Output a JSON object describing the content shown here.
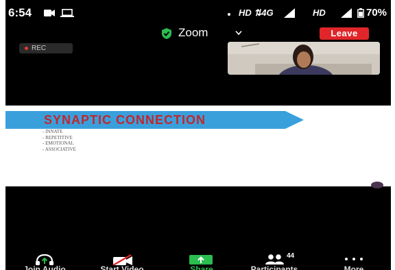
{
  "status_bar": {
    "time": "6:54",
    "network_left": "HD ⇅4G",
    "network_right": "HD",
    "battery": "70%"
  },
  "header": {
    "app_title": "Zoom",
    "leave_label": "Leave",
    "rec_label": "REC"
  },
  "slide": {
    "title": "SYNAPTIC CONNECTION",
    "bullets": [
      "- INNATE",
      "- REPETITIVE",
      "- EMOTIONAL",
      "- ASSOCIATIVE"
    ]
  },
  "toolbar": {
    "join_audio": "Join Audio",
    "start_video": "Start Video",
    "share": "Share",
    "participants": "Participants",
    "participants_count": "44",
    "more": "More"
  },
  "colors": {
    "leave": "#e0262a",
    "share": "#2bbd4f",
    "banner": "#3aa0dc",
    "slide_title": "#c1272d",
    "rec_dot": "#e53935"
  },
  "icons": [
    "video-camera-icon",
    "laptop-icon",
    "signal-icon",
    "battery-icon",
    "shield-check-icon",
    "chevron-down-icon",
    "headphones-icon",
    "video-off-icon",
    "share-arrow-icon",
    "participants-icon",
    "more-dots-icon"
  ]
}
